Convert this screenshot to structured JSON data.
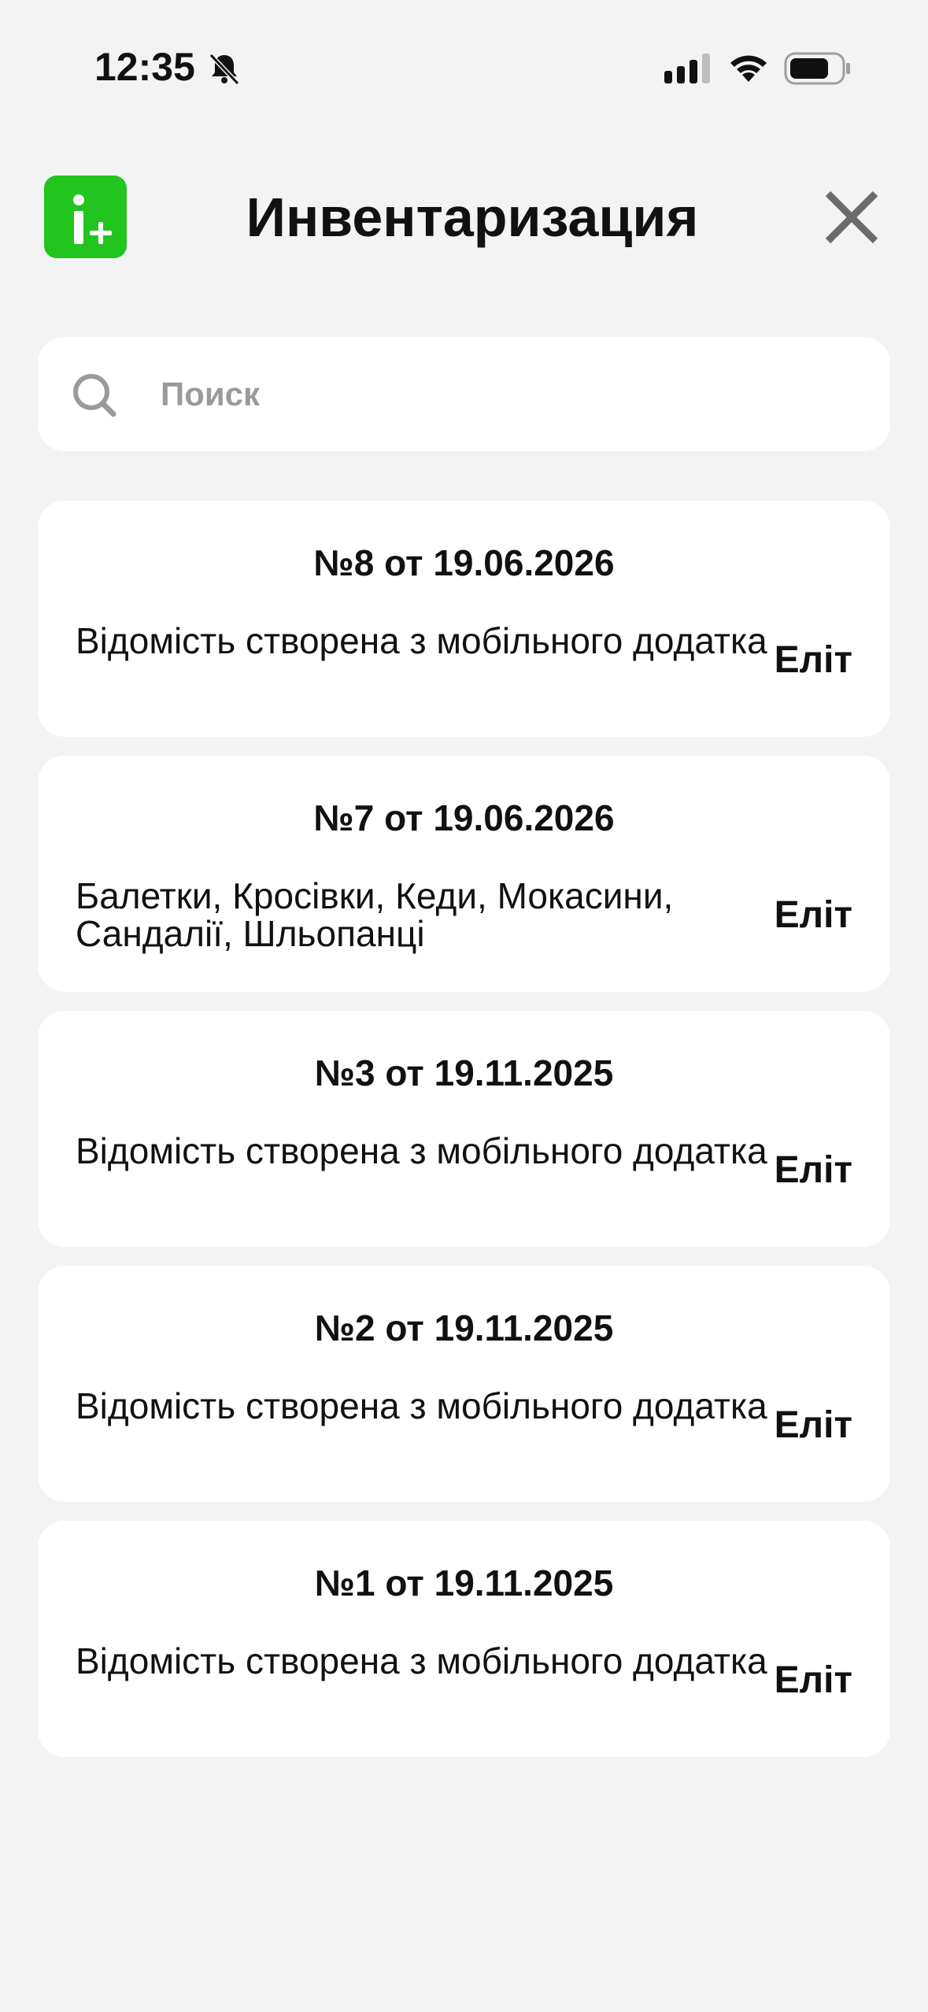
{
  "status_bar": {
    "time": "12:35"
  },
  "header": {
    "title": "Инвентаризация",
    "logo_icon": "inventory-plus-logo",
    "close_icon": "close-icon"
  },
  "search": {
    "placeholder": "Поиск",
    "value": ""
  },
  "documents": [
    {
      "title": "№8 от 19.06.2026",
      "description": "Відомість створена з мобільного додатка",
      "store": "Еліт"
    },
    {
      "title": "№7 от 19.06.2026",
      "description": "Балетки, Кросівки, Кеди, Мокасини, Сандалії, Шльопанці",
      "store": "Еліт"
    },
    {
      "title": "№3 от 19.11.2025",
      "description": "Відомість створена з мобільного додатка",
      "store": "Еліт"
    },
    {
      "title": "№2 от 19.11.2025",
      "description": "Відомість створена з мобільного додатка",
      "store": "Еліт"
    },
    {
      "title": "№1 от 19.11.2025",
      "description": "Відомість створена з мобільного додатка",
      "store": "Еліт"
    }
  ],
  "colors": {
    "background": "#f3f3f3",
    "card": "#ffffff",
    "brand_green": "#22c41e",
    "text": "#111111",
    "placeholder": "#9a9a9a"
  }
}
